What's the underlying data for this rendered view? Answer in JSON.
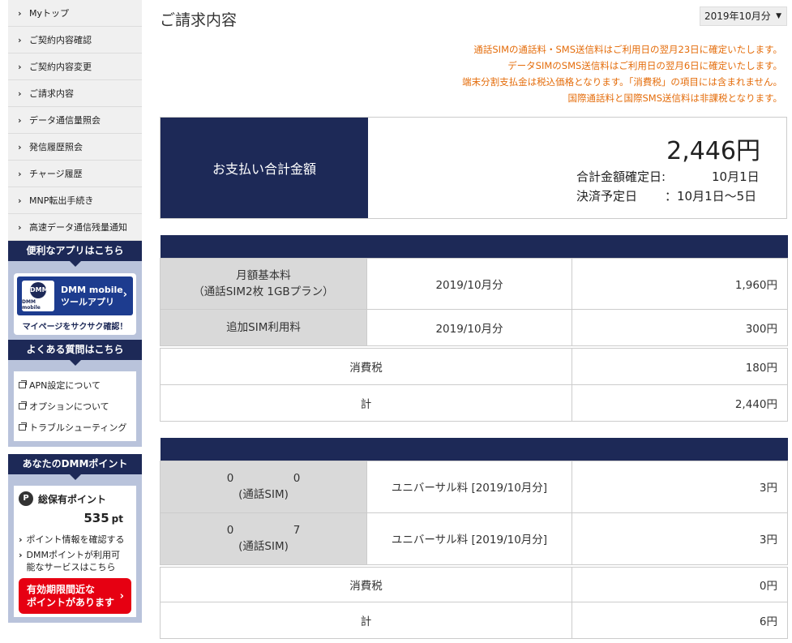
{
  "sidebar": {
    "nav": [
      "Myトップ",
      "ご契約内容確認",
      "ご契約内容変更",
      "ご請求内容",
      "データ通信量照会",
      "発信履歴照会",
      "チャージ履歴",
      "MNP転出手続き",
      "高速データ通信残量通知"
    ],
    "app_header": "便利なアプリはこちら",
    "app_logo_text": "DMM",
    "app_logo_sub": "DMM mobile",
    "app_line1": "DMM mobile",
    "app_line2": "ツールアプリ",
    "app_caption": "マイページをサクサク確認！",
    "faq_header": "よくある質問はこちら",
    "faq": [
      "APN設定について",
      "オプションについて",
      "トラブルシューティング"
    ],
    "points_header": "あなたのDMMポイント",
    "points_title": "総保有ポイント",
    "points_value": "535",
    "points_unit": "pt",
    "points_link1": "ポイント情報を確認する",
    "points_link2a": "DMMポイントが利用可",
    "points_link2b": "能なサービスはこちら",
    "expire_line1": "有効期限間近な",
    "expire_line2": "ポイントがあります"
  },
  "main": {
    "title": "ご請求内容",
    "month": "2019年10月分",
    "notes": [
      "通話SIMの通話料・SMS送信料はご利用日の翌月23日に確定いたします。",
      "データSIMのSMS送信料はご利用日の翌月6日に確定いたします。",
      "端末分割支払金は税込価格となります。「消費税」の項目には含まれません。",
      "国際通話料と国際SMS送信料は非課税となります。"
    ],
    "total_label": "お支払い合計金額",
    "total_amount": "2,446円",
    "confirm_label": "合計金額確定日:",
    "confirm_date": "10月1日",
    "payment_label": "決済予定日",
    "payment_date": "：10月1日〜5日",
    "table1": {
      "row1_label1": "月額基本料",
      "row1_label2": "（通話SIM2枚 1GBプラン）",
      "row1_period": "2019/10月分",
      "row1_amount": "1,960円",
      "row2_label": "追加SIM利用料",
      "row2_period": "2019/10月分",
      "row2_amount": "300円",
      "tax_label": "消費税",
      "tax_amount": "180円",
      "sum_label": "計",
      "sum_amount": "2,440円"
    },
    "table2": {
      "sim1_num_a": "0",
      "sim1_num_b": "0",
      "sim1_type": "(通話SIM)",
      "sim1_item": "ユニバーサル料 [2019/10月分]",
      "sim1_amount": "3円",
      "sim2_num_a": "0",
      "sim2_num_b": "7",
      "sim2_type": "(通話SIM)",
      "sim2_item": "ユニバーサル料 [2019/10月分]",
      "sim2_amount": "3円",
      "tax_label": "消費税",
      "tax_amount": "0円",
      "sum_label": "計",
      "sum_amount": "6円"
    }
  }
}
